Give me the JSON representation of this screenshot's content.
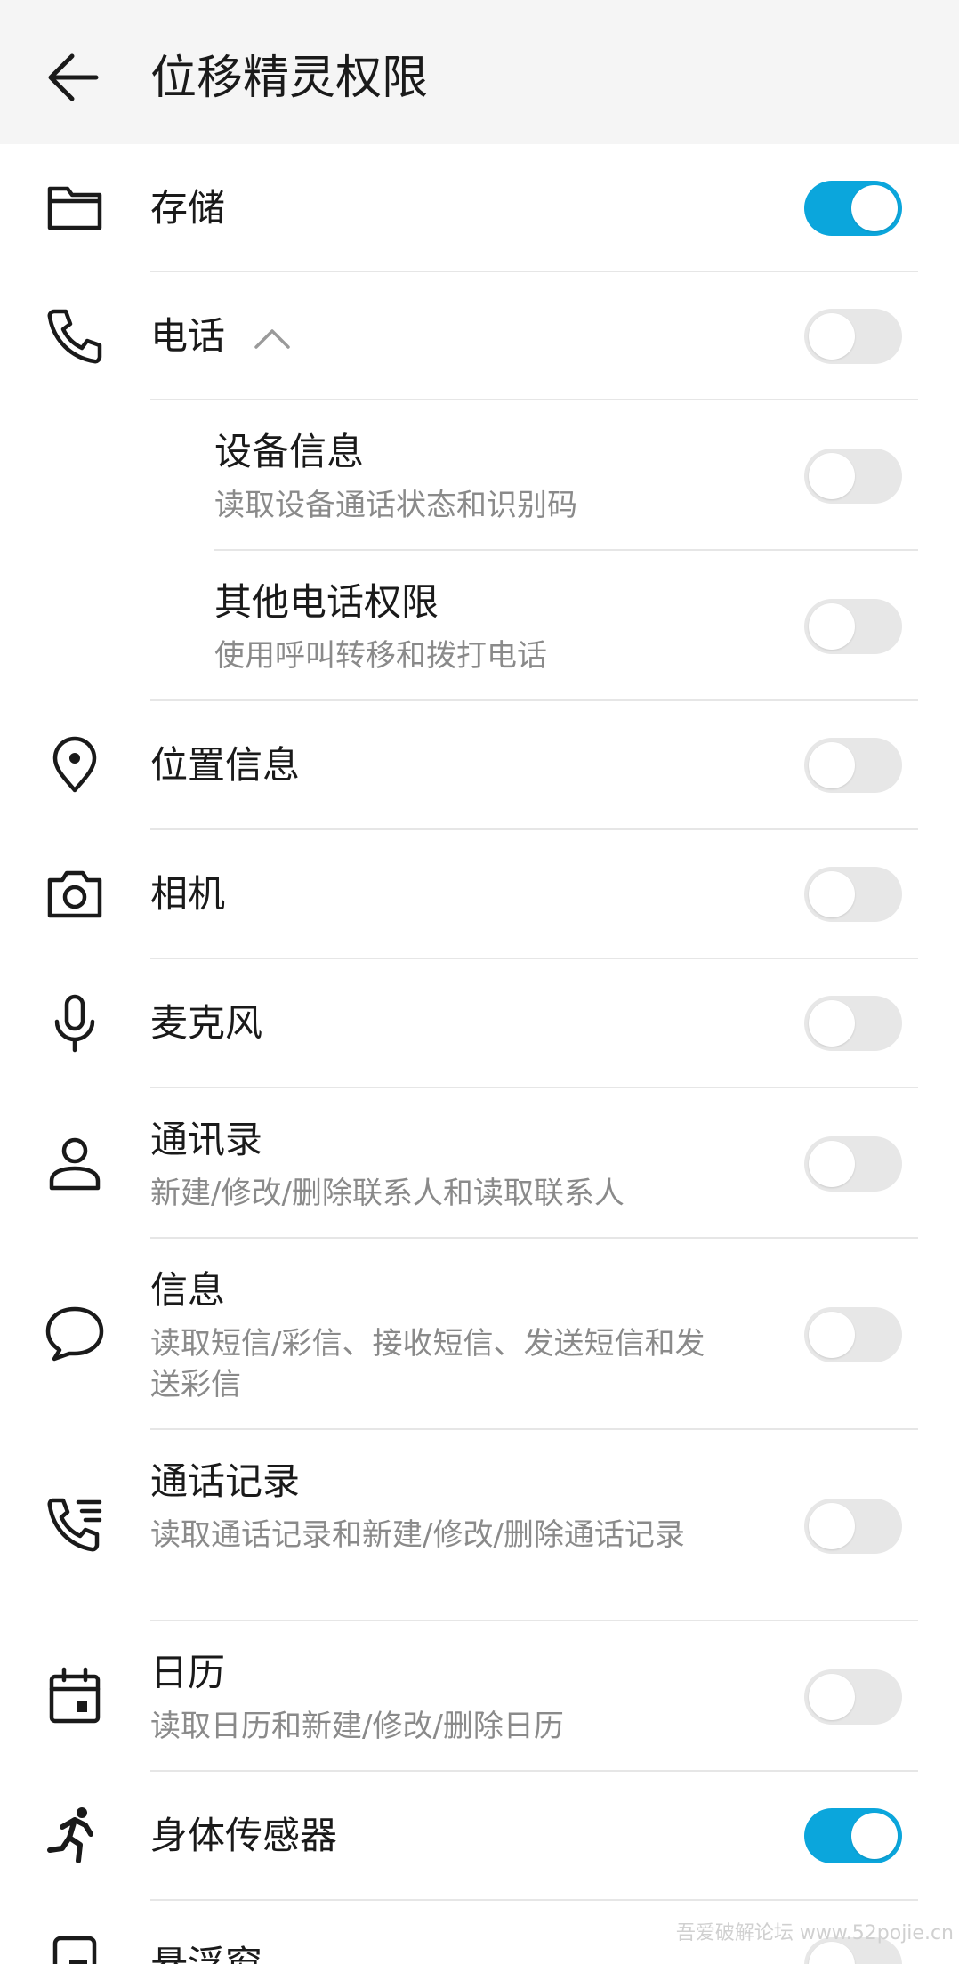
{
  "header": {
    "title": "位移精灵权限"
  },
  "items": [
    {
      "label": "存储",
      "on": true
    },
    {
      "label": "电话",
      "on": false
    },
    {
      "label": "设备信息",
      "desc": "读取设备通话状态和识别码",
      "on": false
    },
    {
      "label": "其他电话权限",
      "desc": "使用呼叫转移和拨打电话",
      "on": false
    },
    {
      "label": "位置信息",
      "on": false
    },
    {
      "label": "相机",
      "on": false
    },
    {
      "label": "麦克风",
      "on": false
    },
    {
      "label": "通讯录",
      "desc": "新建/修改/删除联系人和读取联系人",
      "on": false
    },
    {
      "label": "信息",
      "desc": "读取短信/彩信、接收短信、发送短信和发送彩信",
      "on": false
    },
    {
      "label": "通话记录",
      "desc": "读取通话记录和新建/修改/删除通话记录",
      "on": false
    },
    {
      "label": "日历",
      "desc": "读取日历和新建/修改/删除日历",
      "on": false
    },
    {
      "label": "身体传感器",
      "on": true
    },
    {
      "label": "悬浮窗",
      "on": false
    }
  ],
  "icons": {
    "back": "arrow-left-icon",
    "storage": "folder-icon",
    "phone": "phone-icon",
    "location": "location-pin-icon",
    "camera": "camera-icon",
    "microphone": "microphone-icon",
    "contacts": "person-icon",
    "messages": "chat-bubble-icon",
    "call_log": "call-log-icon",
    "calendar": "calendar-icon",
    "body_sensors": "running-person-icon",
    "floating_window": "floating-window-icon"
  },
  "colors": {
    "toggle_on": "#0ba6dc",
    "toggle_off": "#e7e7e7",
    "header_bg": "#f5f5f5",
    "secondary_text": "#8a8a8a"
  },
  "watermark": "吾爱破解论坛 www.52pojie.cn"
}
